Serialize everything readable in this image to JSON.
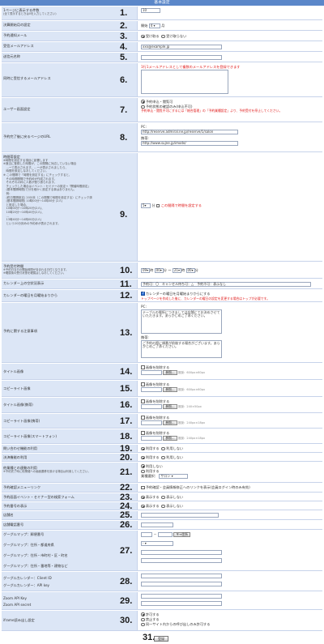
{
  "title": "基本設定",
  "rows": [
    {
      "num": "1.",
      "label": "1ページに表示する件数",
      "sub": "(全て表示するときは0を入力してください)",
      "value": "10"
    },
    {
      "num": "2.",
      "label": "決算開始月の設定",
      "prefix": "開始",
      "month": "4",
      "suffix": "月"
    },
    {
      "num": "3.",
      "label": "予約通知メール",
      "options": [
        "受け取る",
        "受け取らない"
      ],
      "selected": 0
    },
    {
      "num": "4.",
      "label": "受信メールアドレス",
      "value": "xxx@example.jp"
    },
    {
      "num": "5.",
      "label": "送信元名称",
      "value": ""
    },
    {
      "num": "6.",
      "label": "同時に受信するメールアドレス",
      "note": "1行1メールアドレスとして複数のメールアドレスを登録できます"
    },
    {
      "num": "7.",
      "label": "ユーザー画面設定",
      "options": [
        "予約申込・閲覧可",
        "予約状態の確認のみ(申込不可)"
      ],
      "selected": 0,
      "note": "予約申込・閲覧不可にするには「総合管理」の「予約業種設定」より、予約受付を停止してください。"
    },
    {
      "num": "8.",
      "label": "予約完了後に戻るページのURL",
      "pc_label": "PC:",
      "pc_value": "http://reserve.admiral.ne.jp/reserve/1/salon",
      "mobile_label": "携帯:",
      "mobile_value": "http://www.sujne.jp/imode/"
    },
    {
      "num": "9.",
      "label": "時間帯設定",
      "desc": "※時間を設定する項目に影響します\n※適当に登録した時間が、この間隔に対応していない場合\n　…ーで表示されます。…ーが表示されましたら、\n　時間を設定しなおしてください。\n※ この間隔で「時間を設定する」にチェックすると、\n　その時間間隔で予約枠が作成されます。\n　それぞれの枠に人数が割り振られます。\n　チェックした場合はイベント・セミナーの設定→「開催時間設定」\n　(基本間隔時間)で分を細かく設定する事はありません。\n　例：\n　(終日間隔設定) 20分未（この間隔で時間を設定する）にチェック済\n　(基本間隔時間) 10時00分〜14時00分 (2人)\n　と設定した場合、\n　10時00分〜10時20分(2人)、\n　10時20分〜10時40分(2人)、\n　…\n　13時40分〜14時00分(2人)\n　という20分刻みの予約枠が表示されます。",
      "unit_value": "5",
      "unit_suffix": "分",
      "check_label": "この間隔で時間を設定する"
    },
    {
      "num": "10.",
      "label": "予約受付時間",
      "sub": "※予約日当日の開始時間が含まれる日付となります。\n※曜属後の受付状態を曜属はしなおしてください。",
      "from_h": "09",
      "from_m": "00",
      "to_h": "21",
      "to_m": "00",
      "h": "時",
      "m": "分",
      "tilde": "〜"
    },
    {
      "num": "11.",
      "label": "カレンダー上の空状況表示",
      "text": "予約可：〇　キャンセル待ち可：△　予約不可：表示なし"
    },
    {
      "num": "12.",
      "label": "カレンダーの曜日を月曜始まりから",
      "check_label": "カレンダーの曜日を月曜始まりからにする",
      "note": "トップページを作成した後に、カレンダーの曜日の設定を変更する場合はトップが必要です。"
    },
    {
      "num": "13.",
      "label": "予約に関する注意事項",
      "pc_label": "PC:",
      "pc_text": "テーブルの場所につきましては店舗にてお決めさせていただきます。あらかじめご了承ください。",
      "mobile_label": "携帯:",
      "mobile_text": "ご予約の際に順番が前後する場合がございます。あらかじめご了承ください。"
    },
    {
      "num": "14.",
      "label": "タイトル画像",
      "check_label": "画像を削除する",
      "button": "参照...",
      "size_label": "推奨：",
      "size": "600px×60px"
    },
    {
      "num": "15.",
      "label": "コピーライト画像",
      "check_label": "画像を削除する",
      "button": "参照...",
      "size_label": "推奨：",
      "size": "600px×60px"
    },
    {
      "num": "16.",
      "label": "タイトル画像(携帯)",
      "check_label": "画像を削除する",
      "button": "参照...",
      "size_label": "推奨：",
      "size": "240×50px"
    },
    {
      "num": "17.",
      "label": "コピーライト画像(携帯)",
      "check_label": "画像を削除する",
      "button": "参照...",
      "size_label": "推奨：",
      "size": "240px×18px"
    },
    {
      "num": "18.",
      "label": "コピーライト画像(スマートフォン)",
      "check_label": "画像を削除する",
      "button": "参照...",
      "size_label": "推奨：",
      "size": "240px×18px"
    },
    {
      "num": "19.",
      "label": "問い合わせ機能の利用",
      "options": [
        "利用する",
        "利用しない"
      ],
      "selected": 0
    },
    {
      "num": "20.",
      "label": "決済機能の利用",
      "options": [
        "利用する",
        "利用しない"
      ],
      "selected": 0
    },
    {
      "num": "21.",
      "label": "他業種との連動の利用",
      "sub": "※予約完了時に他業種への画面遷移を設ける場合は利用してください。",
      "options": [
        "利用しない",
        "利用する"
      ],
      "selected": 0,
      "select_label": "業種選択：",
      "select_value": "サロン"
    },
    {
      "num": "22.",
      "label": "予約確認メニューリンク",
      "check_label": "予約確認・会員情報修正へのリンクを表示(会員ログイン時のみ有効)"
    },
    {
      "num": "23.",
      "label": "予約画面イベント・セミナー型の検索フォーム",
      "options": [
        "表示する",
        "表示しない"
      ],
      "selected": 0
    },
    {
      "num": "24.",
      "label": "予約番号の表示",
      "options": [
        "表示する",
        "表示しない"
      ],
      "selected": 0
    },
    {
      "num": "25.",
      "label": "店舗名",
      "value": ""
    },
    {
      "num": "26.",
      "label": "店舗電話番号",
      "value": ""
    },
    {
      "num": "27.",
      "label_1": "グーグルマップ：郵便番号",
      "label_2": "グーグルマップ：住所・都道府県",
      "label_3": "グーグルマップ：住所・市町村・区・町名",
      "label_4": "グーグルマップ：住所・番地等・建物など",
      "zip_button": "〒→住所",
      "dash": "－"
    },
    {
      "num": "28.",
      "label_1": "グーグルカレンダー：Client ID",
      "label_2": "グーグルカレンダー：API key"
    },
    {
      "num": "29.",
      "label_1": "Zoom API Key",
      "label_2": "Zoom API secret"
    },
    {
      "num": "30.",
      "label": "iframe読み出し設定",
      "options": [
        "許可する",
        "禁止する",
        "同一サイト内からの呼び出しのみ許可する"
      ],
      "selected": 0
    }
  ],
  "save": {
    "num": "31.",
    "label": "登録"
  }
}
